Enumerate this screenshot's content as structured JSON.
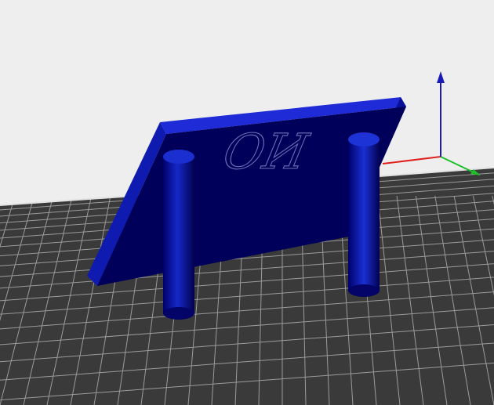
{
  "viewport": {
    "background_color": "#eeeeee",
    "bed_color": "#3a3a3a",
    "grid_line_color": "#9a9a9a",
    "bed_edge_color": "#e2e2e2"
  },
  "model": {
    "body_color": "#0a0f9a",
    "dark_face_color": "#00005a",
    "highlight_color": "#1e2bd6",
    "embossed_text": "OИ"
  },
  "axes": {
    "x_color": "#e0201c",
    "y_color": "#1fbf2a",
    "z_color": "#1a1ab8"
  }
}
